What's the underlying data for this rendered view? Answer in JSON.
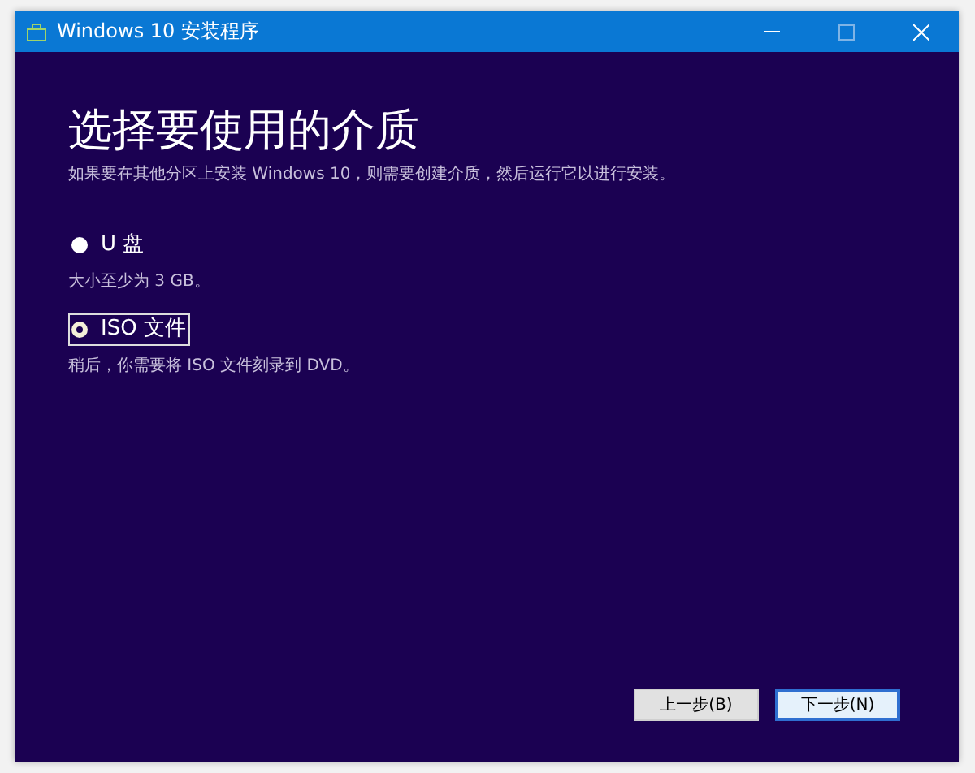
{
  "window": {
    "title": "Windows 10 安装程序"
  },
  "heading": "选择要使用的介质",
  "subtitle": "如果要在其他分区上安装 Windows 10，则需要创建介质，然后运行它以进行安装。",
  "options": [
    {
      "label": "U 盘",
      "description": "大小至少为 3 GB。",
      "selected": false
    },
    {
      "label": "ISO 文件",
      "description": "稍后，你需要将 ISO 文件刻录到 DVD。",
      "selected": true
    }
  ],
  "buttons": [
    {
      "label": "上一步(B)",
      "kind": "back"
    },
    {
      "label": "下一步(N)",
      "kind": "next"
    }
  ]
}
